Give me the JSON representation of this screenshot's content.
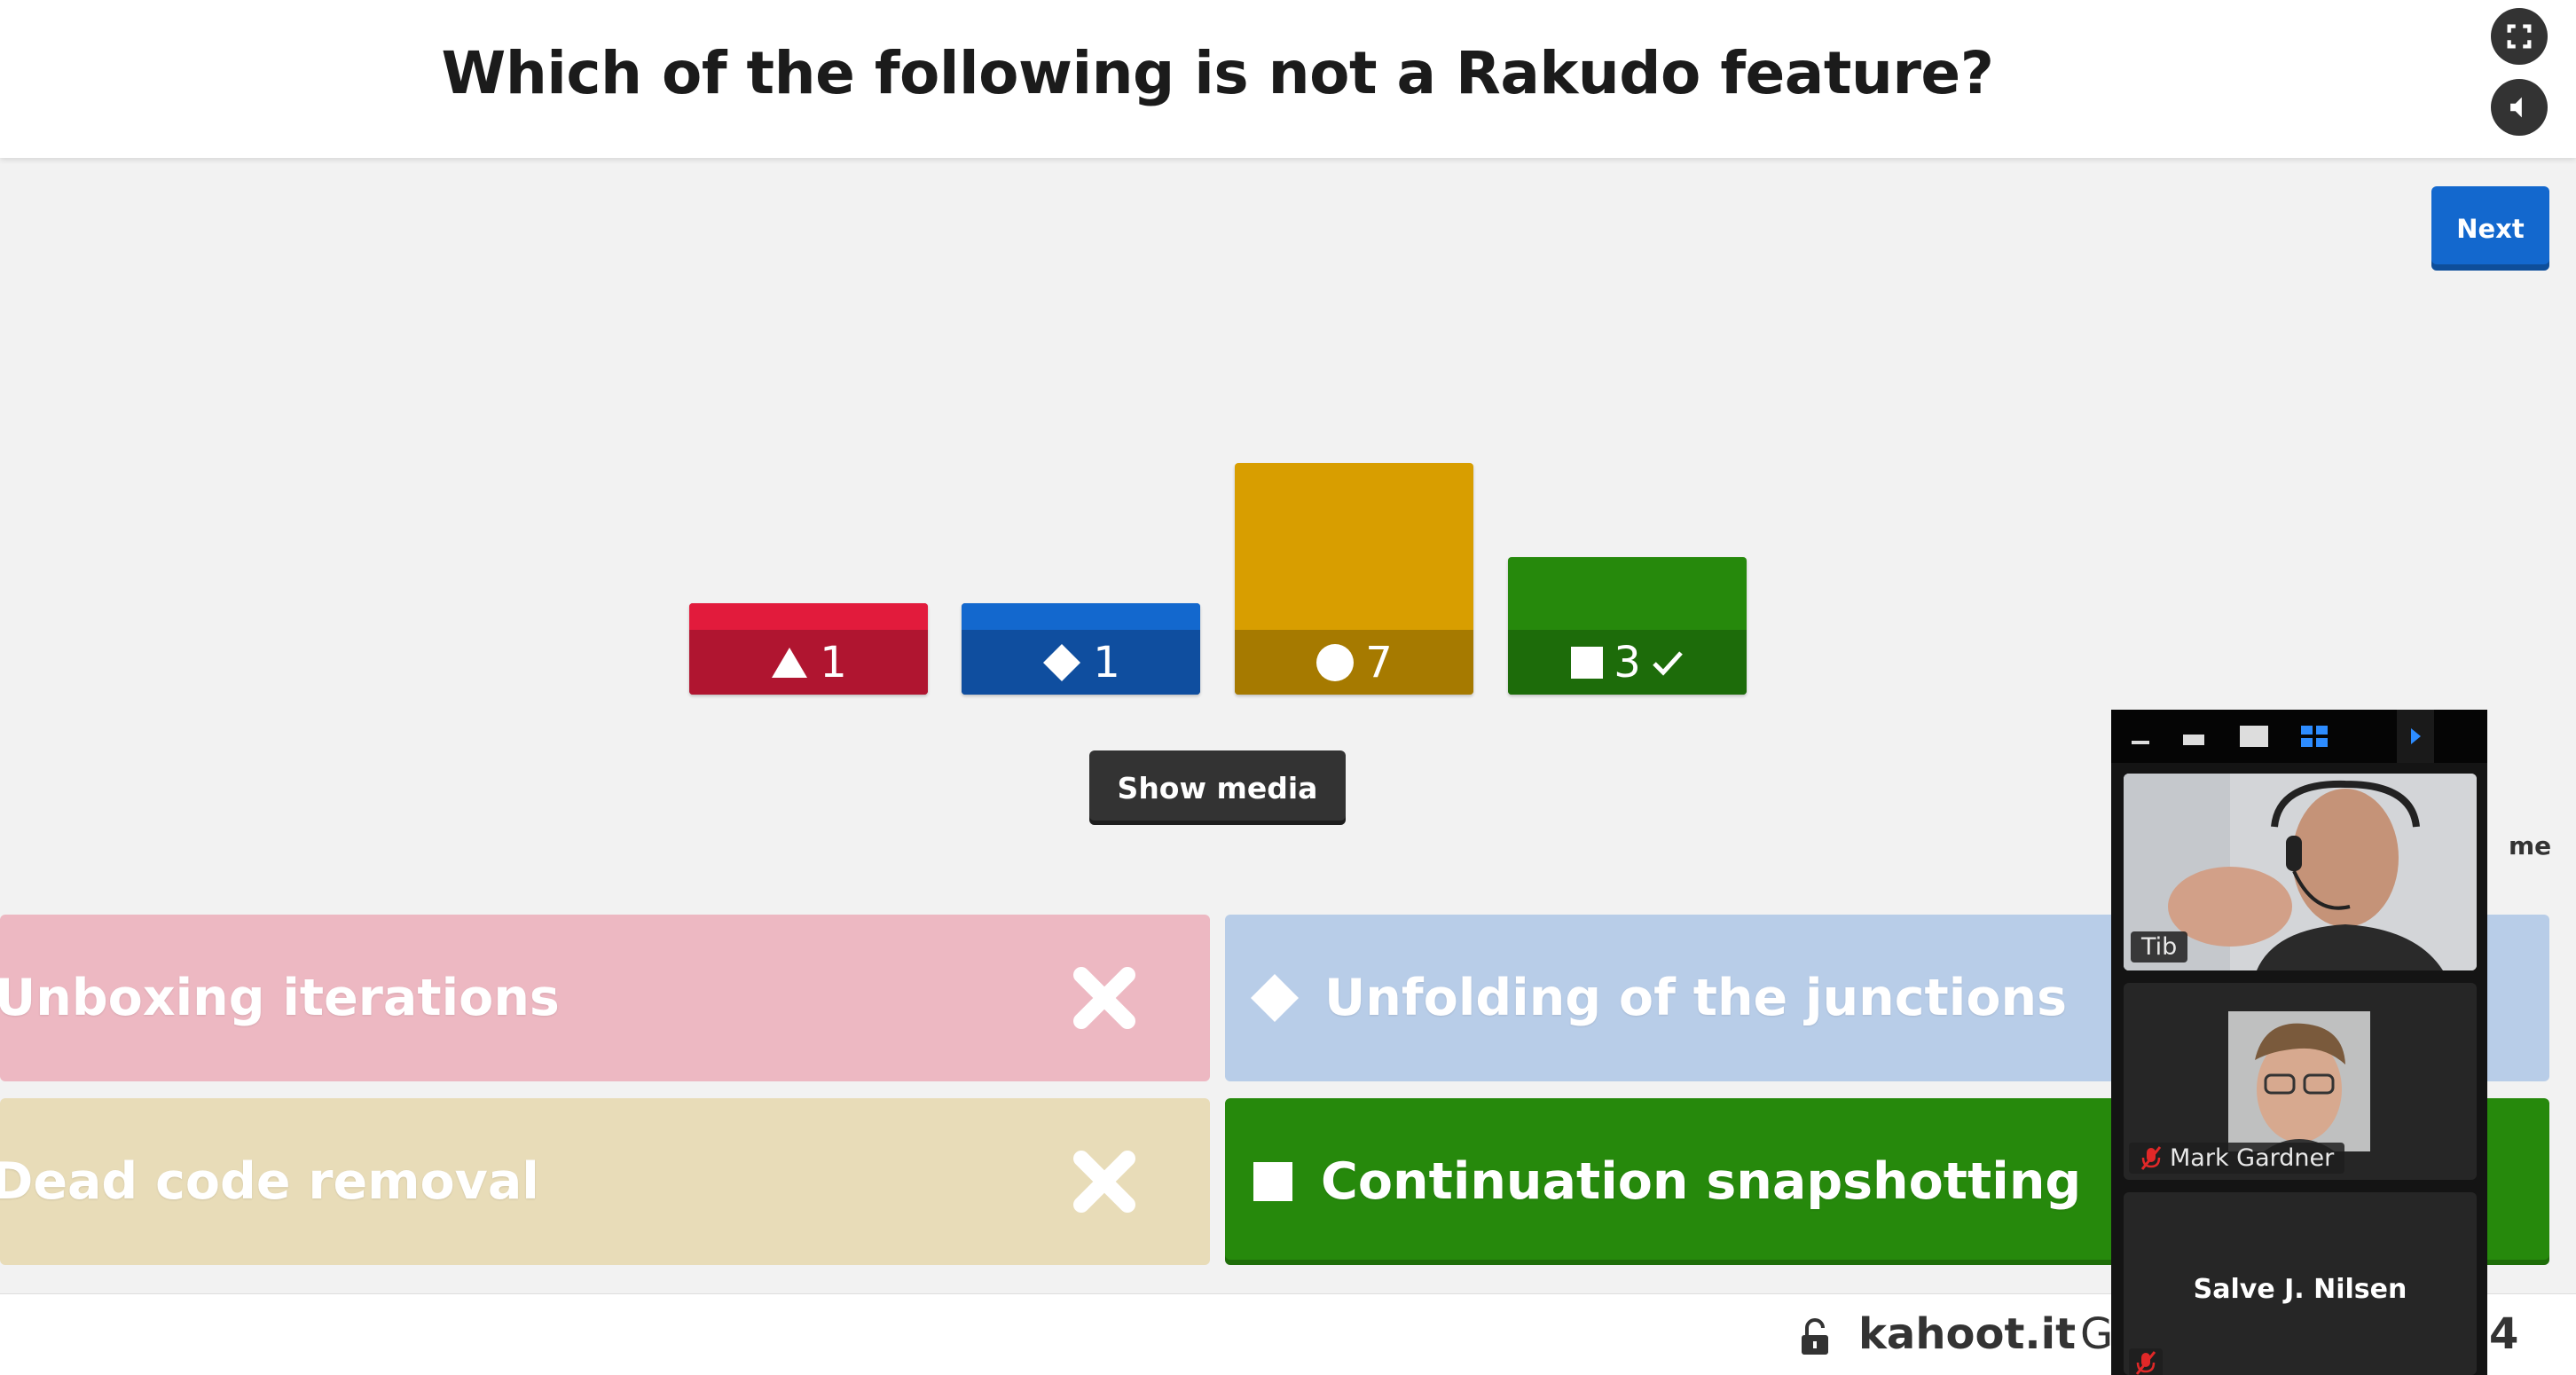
{
  "question": "Which of the following is not a Rakudo feature?",
  "buttons": {
    "next": "Next",
    "show_media": "Show media"
  },
  "results": [
    {
      "shape": "triangle",
      "count": "1",
      "color": "#e21b3c",
      "correct": false
    },
    {
      "shape": "diamond",
      "count": "1",
      "color": "#1368ce",
      "correct": false
    },
    {
      "shape": "circle",
      "count": "7",
      "color": "#d89e00",
      "correct": false
    },
    {
      "shape": "square",
      "count": "3",
      "color": "#26890c",
      "correct": true
    }
  ],
  "answers": [
    {
      "text": "Unboxing iterations",
      "shape": "triangle",
      "state": "incorrect"
    },
    {
      "text": "Unfolding of the junctions",
      "shape": "diamond",
      "state": "incorrect"
    },
    {
      "text": "Dead code removal",
      "shape": "circle",
      "state": "incorrect"
    },
    {
      "text": "Continuation snapshotting",
      "shape": "square",
      "state": "correct"
    }
  ],
  "footer": {
    "brand": "kahoot.it",
    "partial_left": "G",
    "partial_right": "4",
    "partial_me": "me"
  },
  "video_panel": {
    "participants": [
      {
        "name": "Tib",
        "muted": false
      },
      {
        "name": "Mark Gardner",
        "muted": true
      },
      {
        "name": "Salve J. Nilsen",
        "muted": true
      }
    ]
  },
  "icons": [
    "fullscreen-icon",
    "volume-icon",
    "lock-icon",
    "muted-mic-icon"
  ]
}
